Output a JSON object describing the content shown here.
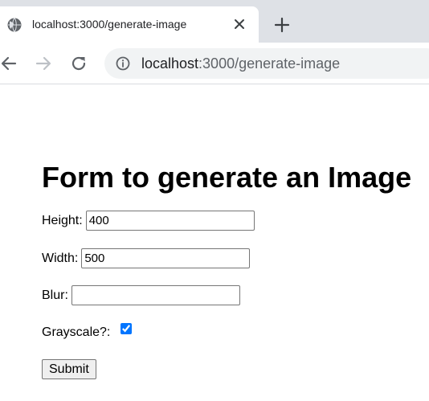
{
  "browser": {
    "tab_title": "localhost:3000/generate-image",
    "url_host": "localhost",
    "url_path": ":3000/generate-image",
    "icons": {
      "tab_favicon": "globe-icon",
      "tab_close": "close-icon",
      "new_tab": "plus-icon",
      "back": "arrow-left-icon",
      "forward": "arrow-right-icon",
      "reload": "reload-icon",
      "site_info": "info-icon"
    }
  },
  "page": {
    "title": "Form to generate an Image",
    "fields": {
      "height_label": "Height:",
      "height_value": "400",
      "width_label": "Width:",
      "width_value": "500",
      "blur_label": "Blur:",
      "blur_value": "",
      "grayscale_label": "Grayscale?:",
      "grayscale_checked": true
    },
    "submit_label": "Submit"
  }
}
